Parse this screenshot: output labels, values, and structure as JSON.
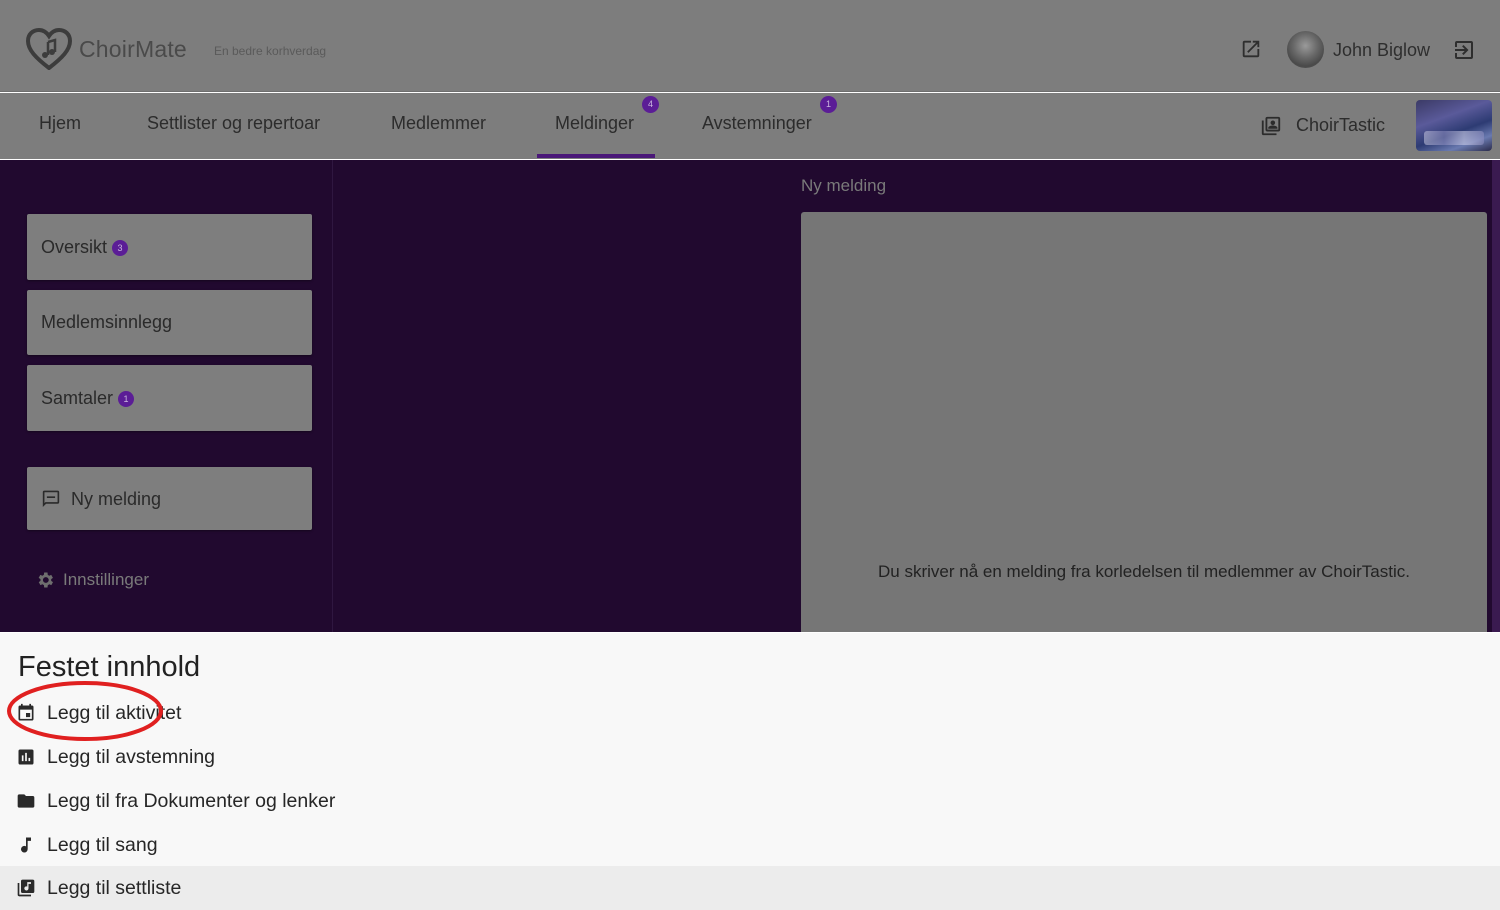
{
  "header": {
    "brand": "ChoirMate",
    "tagline": "En bedre korhverdag",
    "user_name": "John Biglow"
  },
  "nav": {
    "items": [
      {
        "label": "Hjem"
      },
      {
        "label": "Settlister og repertoar"
      },
      {
        "label": "Medlemmer"
      },
      {
        "label": "Meldinger",
        "badge": "4",
        "active": true
      },
      {
        "label": "Avstemninger",
        "badge": "1"
      }
    ],
    "choir_name": "ChoirTastic"
  },
  "sidebar": {
    "items": [
      {
        "label": "Oversikt",
        "badge": "3"
      },
      {
        "label": "Medlemsinnlegg"
      },
      {
        "label": "Samtaler",
        "badge": "1"
      }
    ],
    "new_message": "Ny melding",
    "settings": "Innstillinger"
  },
  "compose": {
    "heading": "Ny melding",
    "info": "Du skriver nå en melding fra korledelsen til medlemmer av ChoirTastic."
  },
  "pinned": {
    "title": "Festet innhold",
    "items": [
      {
        "label": "Legg til aktivitet",
        "icon": "calendar-icon"
      },
      {
        "label": "Legg til avstemning",
        "icon": "poll-icon"
      },
      {
        "label": "Legg til fra Dokumenter og lenker",
        "icon": "folder-icon"
      },
      {
        "label": "Legg til sang",
        "icon": "music-note-icon"
      },
      {
        "label": "Legg til settliste",
        "icon": "setlist-icon"
      }
    ]
  },
  "colors": {
    "accent": "#5b1d96",
    "dark_background": "#21092f",
    "annotation": "#e02020"
  }
}
